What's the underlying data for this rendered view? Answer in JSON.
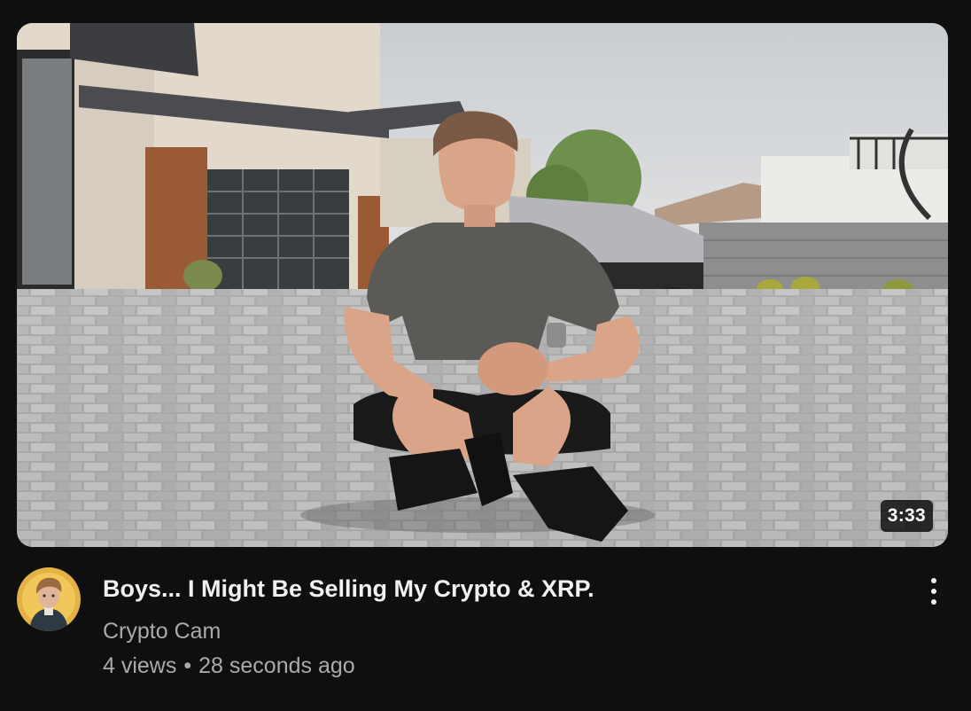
{
  "video": {
    "title": "Boys... I Might Be Selling My Crypto & XRP.",
    "duration": "3:33",
    "channel": "Crypto Cam",
    "views": "4 views",
    "separator": "•",
    "age": "28 seconds ago"
  },
  "icons": {
    "menu": "more-vert-icon",
    "avatar": "channel-avatar"
  },
  "colors": {
    "background": "#0f0f0f",
    "title": "#f1f1f1",
    "secondary_text": "#aaaaaa",
    "duration_badge": "#000000"
  }
}
